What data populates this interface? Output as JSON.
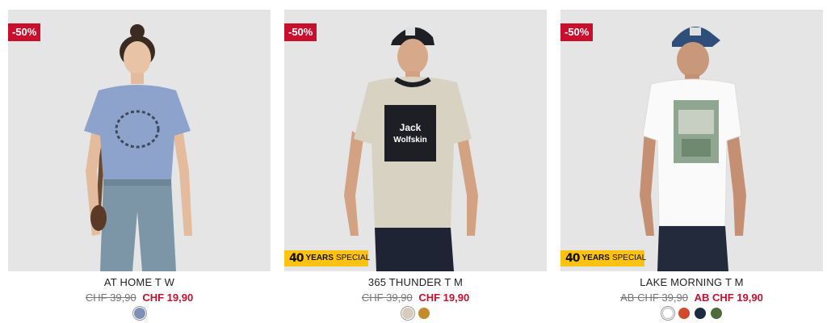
{
  "products": [
    {
      "discount": "-50%",
      "name": "AT HOME T W",
      "old_price": "CHF 39,90",
      "new_price": "CHF 19,90",
      "special": null,
      "shirt_color": "#8ea3cc",
      "swatches": [
        "#7e8fb8"
      ]
    },
    {
      "discount": "-50%",
      "name": "365 THUNDER T M",
      "old_price": "CHF 39,90",
      "new_price": "CHF 19,90",
      "special": {
        "logo": "40",
        "word1": "YEARS",
        "word2": "SPECIAL"
      },
      "shirt_color": "#d8d2c2",
      "swatches": [
        "#d7ccb9",
        "#c58a2a"
      ]
    },
    {
      "discount": "-50%",
      "name": "LAKE MORNING T M",
      "old_price": "AB CHF 39,90",
      "new_price": "AB CHF 19,90",
      "special": {
        "logo": "40",
        "word1": "YEARS",
        "word2": "SPECIAL"
      },
      "shirt_color": "#fafafa",
      "swatches": [
        "#ffffff",
        "#d24a2c",
        "#1d2a44",
        "#4e6b3c"
      ]
    }
  ],
  "colors": {
    "accent": "#c8102e",
    "special": "#ffc20e",
    "image_bg": "#e5e5e5"
  }
}
